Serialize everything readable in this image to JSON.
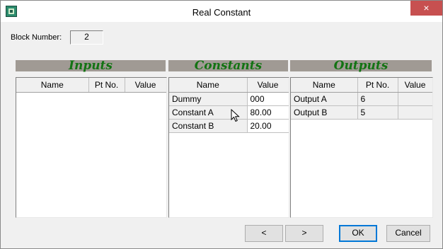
{
  "window": {
    "title": "Real Constant",
    "close_glyph": "×"
  },
  "block": {
    "label": "Block Number:",
    "value": "2"
  },
  "sections": {
    "inputs": "Inputs",
    "constants": "Constants",
    "outputs": "Outputs"
  },
  "inputs_table": {
    "columns": [
      "Name",
      "Pt No.",
      "Value"
    ],
    "rows": []
  },
  "constants_table": {
    "columns": [
      "Name",
      "Value"
    ],
    "rows": [
      {
        "name": "Dummy",
        "value": "000"
      },
      {
        "name": "Constant A",
        "value": "80.00"
      },
      {
        "name": "Constant B",
        "value": "20.00"
      }
    ]
  },
  "outputs_table": {
    "columns": [
      "Name",
      "Pt No.",
      "Value"
    ],
    "rows": [
      {
        "name": "Output A",
        "pt": "6",
        "value": ""
      },
      {
        "name": "Output B",
        "pt": "5",
        "value": ""
      }
    ]
  },
  "buttons": {
    "prev": "<",
    "next": ">",
    "ok": "OK",
    "cancel": "Cancel"
  },
  "colors": {
    "section_text": "#137313",
    "section_bar": "#a09a94",
    "close": "#c75050"
  }
}
